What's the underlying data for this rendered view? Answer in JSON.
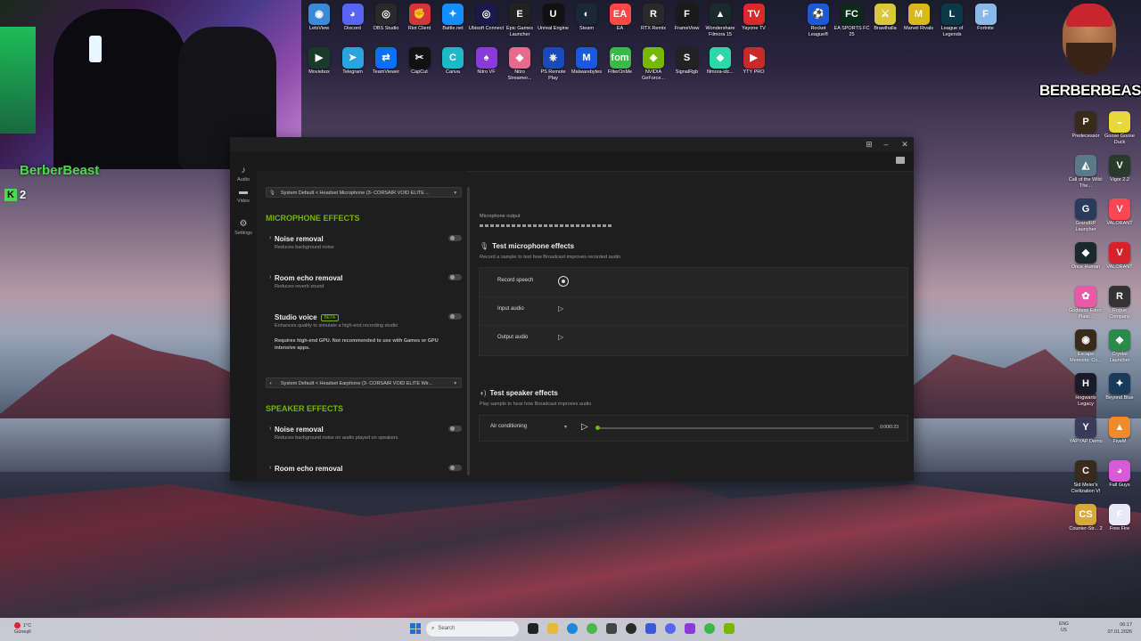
{
  "webcam": {
    "streamer_name": "BerberBeast",
    "kick_count": "2",
    "kick_icon": "K"
  },
  "brand_logo": {
    "text": "BERBERBEAST"
  },
  "desktop_top_row1": [
    {
      "label": "LetsView",
      "icon": "letsview-icon",
      "color": "#3a8ad8",
      "glyph": "◉"
    },
    {
      "label": "Discord",
      "icon": "discord-icon",
      "color": "#5865f2",
      "glyph": "◕"
    },
    {
      "label": "OBS Studio",
      "icon": "obs-icon",
      "color": "#2a2a2a",
      "glyph": "◎"
    },
    {
      "label": "Riot Client",
      "icon": "riot-icon",
      "color": "#d13639",
      "glyph": "✊"
    },
    {
      "label": "Battle.net",
      "icon": "battlenet-icon",
      "color": "#148eff",
      "glyph": "✦"
    },
    {
      "label": "Ubisoft Connect",
      "icon": "ubisoft-icon",
      "color": "#1a1a4a",
      "glyph": "◎"
    },
    {
      "label": "Epic Games Launcher",
      "icon": "epic-icon",
      "color": "#222222",
      "glyph": "E"
    },
    {
      "label": "Unreal Engine",
      "icon": "unreal-icon",
      "color": "#111111",
      "glyph": "U"
    },
    {
      "label": "Steam",
      "icon": "steam-icon",
      "color": "#1b2838",
      "glyph": "◐"
    },
    {
      "label": "EA",
      "icon": "ea-icon",
      "color": "#ff4747",
      "glyph": "EA"
    },
    {
      "label": "RTX Remix",
      "icon": "rtx-remix-icon",
      "color": "#2a2a2a",
      "glyph": "R"
    },
    {
      "label": "FrameView",
      "icon": "frameview-icon",
      "color": "#1a1a1a",
      "glyph": "F"
    },
    {
      "label": "Wondershare Filmora 15",
      "icon": "filmora-icon",
      "color": "#1a2a2a",
      "glyph": "▲"
    },
    {
      "label": "Yayone TV",
      "icon": "tv-icon",
      "color": "#d82a2a",
      "glyph": "TV"
    }
  ],
  "desktop_top_row2": [
    {
      "label": "Moviebox",
      "icon": "moviebox-icon",
      "color": "#1a3a2a",
      "glyph": "▶"
    },
    {
      "label": "Telegram",
      "icon": "telegram-icon",
      "color": "#2aa3df",
      "glyph": "➤"
    },
    {
      "label": "TeamViewer",
      "icon": "teamviewer-icon",
      "color": "#0e6ff0",
      "glyph": "⇄"
    },
    {
      "label": "CapCut",
      "icon": "capcut-icon",
      "color": "#111111",
      "glyph": "✂"
    },
    {
      "label": "Canva",
      "icon": "canva-icon",
      "color": "#1fb8c8",
      "glyph": "C"
    },
    {
      "label": "Nitro VF",
      "icon": "nitro-icon",
      "color": "#8a3ad8",
      "glyph": "♠"
    },
    {
      "label": "Nitro Streamer...",
      "icon": "nitro-streamer-icon",
      "color": "#e86a8a",
      "glyph": "◆"
    },
    {
      "label": "PS Remote Play",
      "icon": "ps-remote-icon",
      "color": "#1a4ab8",
      "glyph": "⎈"
    },
    {
      "label": "Malwarebytes",
      "icon": "malwarebytes-icon",
      "color": "#1a5ad8",
      "glyph": "M"
    },
    {
      "label": "FilterOnMe",
      "icon": "filteronme-icon",
      "color": "#3ab84a",
      "glyph": "fom"
    },
    {
      "label": "NVIDIA GeForce...",
      "icon": "nvidia-icon",
      "color": "#76b900",
      "glyph": "◈"
    },
    {
      "label": "SignalRgb",
      "icon": "signalrgb-icon",
      "color": "#222222",
      "glyph": "S"
    },
    {
      "label": "filmora-idc...",
      "icon": "filmora-idc-icon",
      "color": "#2ad8a8",
      "glyph": "◆"
    },
    {
      "label": "YTY PRO",
      "icon": "ytypro-icon",
      "color": "#c82a2a",
      "glyph": "▶"
    }
  ],
  "desktop_top_right": [
    {
      "label": "Rocket League®",
      "icon": "rocket-league-icon",
      "color": "#1a5ad8",
      "glyph": "⚽"
    },
    {
      "label": "EA SPORTS FC 25",
      "icon": "fc25-icon",
      "color": "#0a2a1a",
      "glyph": "FC"
    },
    {
      "label": "Brawlhalla",
      "icon": "brawlhalla-icon",
      "color": "#d8c83a",
      "glyph": "⚔"
    },
    {
      "label": "Marvel Rivals",
      "icon": "marvel-rivals-icon",
      "color": "#d8b81a",
      "glyph": "M"
    },
    {
      "label": "League of Legends",
      "icon": "lol-icon",
      "color": "#0a3a4a",
      "glyph": "L"
    },
    {
      "label": "Fortnite",
      "icon": "fortnite-icon",
      "color": "#8ab8e8",
      "glyph": "F"
    }
  ],
  "desktop_right_col": [
    {
      "label": "Predecessor",
      "icon": "predecessor-icon",
      "color": "#3a2a1a",
      "glyph": "P"
    },
    {
      "label": "Goose Goose Duck",
      "icon": "goose-icon",
      "color": "#e8d83a",
      "glyph": "◒"
    },
    {
      "label": "Call of the Wild: The...",
      "icon": "cotw-icon",
      "color": "#5a7a8a",
      "glyph": "◭"
    },
    {
      "label": "Vigor 2.2",
      "icon": "vigor-icon",
      "color": "#2a3a2a",
      "glyph": "V"
    },
    {
      "label": "GrandRP Launcher",
      "icon": "grandrp-icon",
      "color": "#2a3a5a",
      "glyph": "G"
    },
    {
      "label": "VALORANT",
      "icon": "valorant-icon",
      "color": "#ff4655",
      "glyph": "V"
    },
    {
      "label": "Once Human",
      "icon": "once-human-icon",
      "color": "#1a2a2a",
      "glyph": "◆"
    },
    {
      "label": "VALORANT",
      "icon": "valorant-icon-2",
      "color": "#d8222a",
      "glyph": "V"
    },
    {
      "label": "Goddess Eden: Plate...",
      "icon": "goddess-icon",
      "color": "#e85aa8",
      "glyph": "✿"
    },
    {
      "label": "Rogue Company",
      "icon": "rogue-icon",
      "color": "#333333",
      "glyph": "R"
    },
    {
      "label": "Escape Memoirs: Co...",
      "icon": "escape-icon",
      "color": "#3a2a1a",
      "glyph": "◉"
    },
    {
      "label": "Crystal Launcher",
      "icon": "crystal-icon",
      "color": "#2a8a4a",
      "glyph": "◆"
    },
    {
      "label": "Hogwarts Legacy",
      "icon": "hogwarts-icon",
      "color": "#1a1a2a",
      "glyph": "H"
    },
    {
      "label": "Beyond Blue",
      "icon": "beyond-blue-icon",
      "color": "#1a3a5a",
      "glyph": "✦"
    },
    {
      "label": "YAPYAP Demo",
      "icon": "yapyap-icon",
      "color": "#3a3a5a",
      "glyph": "Y"
    },
    {
      "label": "FiveM",
      "icon": "fivem-icon",
      "color": "#f08a2a",
      "glyph": "▲"
    },
    {
      "label": "Sid Meier's Civilization VI",
      "icon": "civ-icon",
      "color": "#3a2a1a",
      "glyph": "C"
    },
    {
      "label": "Fall Guys",
      "icon": "fall-guys-icon",
      "color": "#d85ad8",
      "glyph": "◕"
    },
    {
      "label": "Counter-Str... 2",
      "icon": "cs2-icon",
      "color": "#d8a83a",
      "glyph": "CS"
    },
    {
      "label": "Free Fire",
      "icon": "free-fire-icon",
      "color": "#e8e8f8",
      "glyph": "F"
    }
  ],
  "app": {
    "nav": [
      {
        "label": "Audio",
        "icon": "audio-icon"
      },
      {
        "label": "Video",
        "icon": "video-icon"
      },
      {
        "label": "Settings",
        "icon": "gear-icon"
      }
    ],
    "mic_source": "System Default < Headset Microphone (3- CORSAIR VOID ELITE ...",
    "mic_section_title": "MICROPHONE EFFECTS",
    "mic_effects": [
      {
        "name": "Noise removal",
        "desc": "Reduces background noise"
      },
      {
        "name": "Room echo removal",
        "desc": "Reduces reverb sound"
      },
      {
        "name": "Studio voice",
        "badge": "BETA",
        "desc": "Enhances quality to simulate a high-end recording studio",
        "warning": "Requires high-end GPU. Not recommended to use with Games or GPU intensive apps."
      }
    ],
    "speaker_source": "System Default < Headset Earphone (3- CORSAIR VOID ELITE Wir...",
    "speaker_section_title": "SPEAKER EFFECTS",
    "speaker_effects": [
      {
        "name": "Noise removal",
        "desc": "Reduces background noise on audio played on speakers"
      },
      {
        "name": "Room echo removal",
        "desc": ""
      }
    ],
    "mic_output_label": "Microphone output",
    "test_mic_title": "Test microphone effects",
    "test_mic_sub": "Record a sample to test how Broadcast improves recorded audio",
    "test_rows": [
      {
        "label": "Record speech"
      },
      {
        "label": "Input audio"
      },
      {
        "label": "Output audio"
      }
    ],
    "test_speaker_title": "Test speaker effects",
    "test_speaker_sub": "Play sample to hear how Broadcast improves audio",
    "sample_name": "Air conditioning",
    "sample_time": "0:00/0:23",
    "sample_progress": 0
  },
  "taskbar": {
    "weather_temp": "1°C",
    "weather_desc": "Güneşli",
    "search_placeholder": "Search",
    "lang": "ENG",
    "lang_sub": "US",
    "time": "06:17",
    "date": "07.01.2026"
  }
}
